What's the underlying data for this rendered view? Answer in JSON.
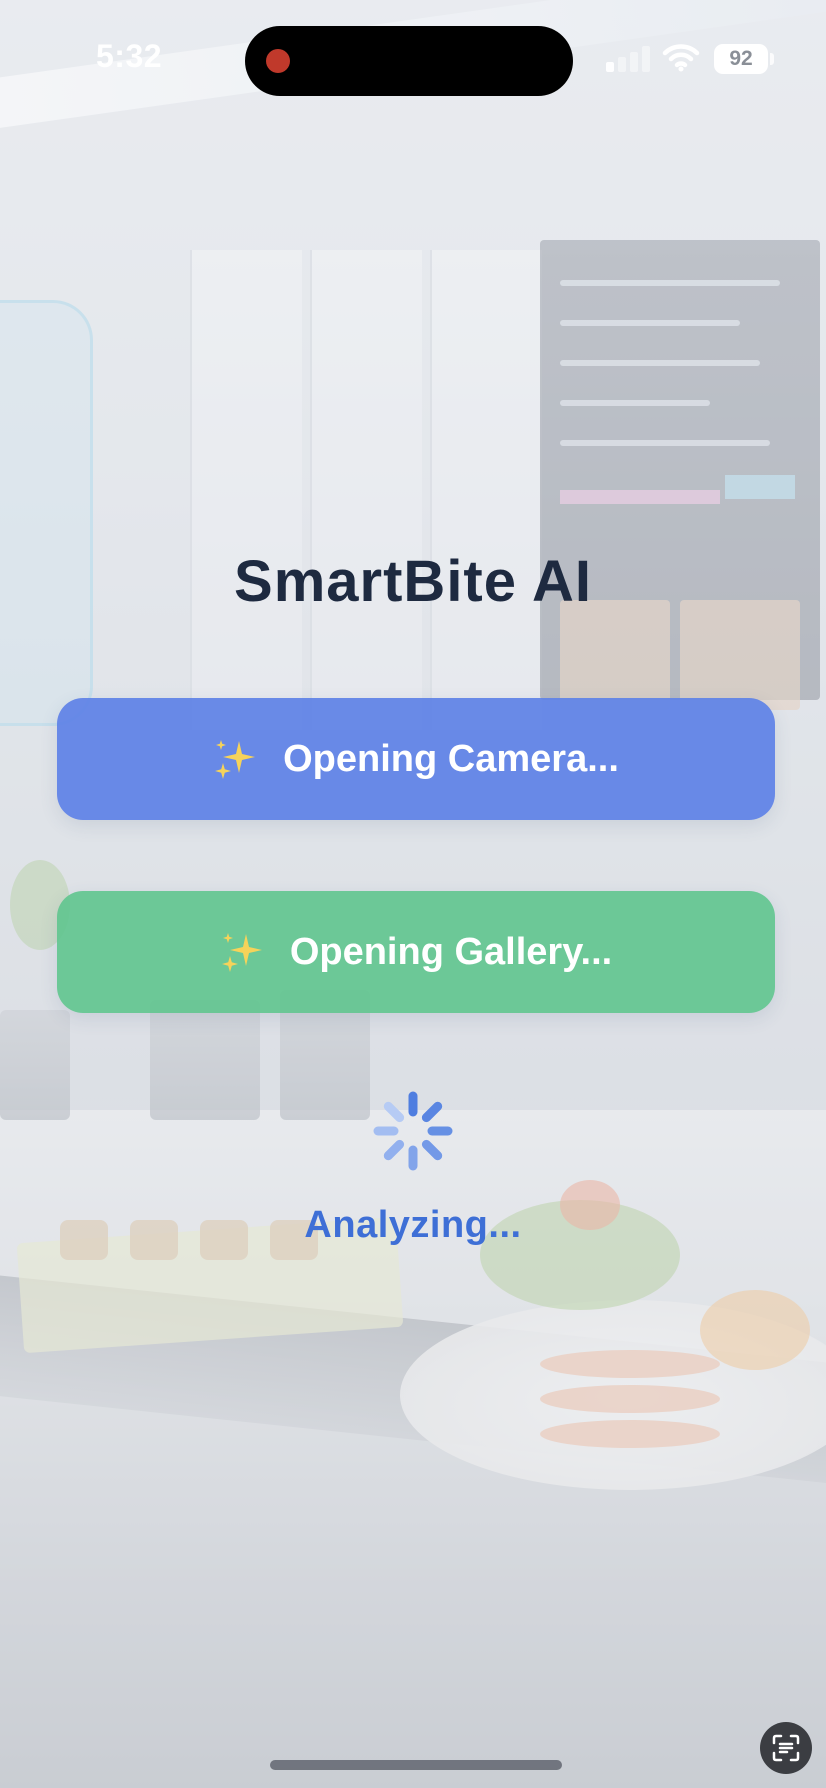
{
  "status_bar": {
    "time": "5:32",
    "battery": "92",
    "icons": [
      "signal-icon",
      "wifi-icon",
      "battery-icon"
    ]
  },
  "app": {
    "title": "SmartBite AI"
  },
  "buttons": {
    "camera": {
      "label": "Opening Camera...",
      "icon": "sparkle-icon",
      "color": "#5f82e6"
    },
    "gallery": {
      "label": "Opening Gallery...",
      "icon": "sparkle-icon",
      "color": "#5cc48c"
    }
  },
  "loading": {
    "icon": "spinner-icon",
    "text": "Analyzing...",
    "color": "#3e6fd6"
  },
  "system": {
    "overlay_icon": "text-scan-icon"
  }
}
